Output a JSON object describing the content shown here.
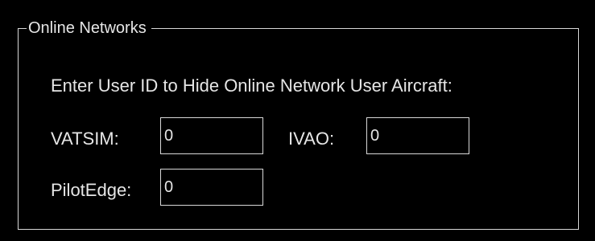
{
  "group": {
    "title": "Online Networks"
  },
  "instruction": "Enter User ID to Hide Online Network User Aircraft:",
  "fields": {
    "vatsim": {
      "label": "VATSIM:",
      "value": "0"
    },
    "ivao": {
      "label": "IVAO:",
      "value": "0"
    },
    "pilotedge": {
      "label": "PilotEdge:",
      "value": "0"
    }
  }
}
